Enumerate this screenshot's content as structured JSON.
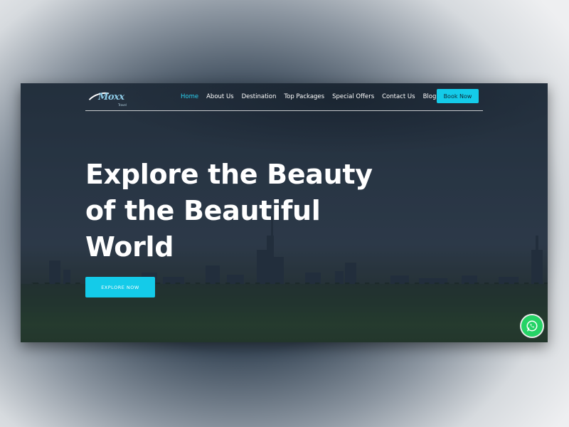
{
  "brand": {
    "logo_text": "Moxx",
    "logo_subtext": "Travel"
  },
  "nav": {
    "items": [
      {
        "label": "Home",
        "active": true
      },
      {
        "label": "About Us",
        "active": false
      },
      {
        "label": "Destination",
        "active": false
      },
      {
        "label": "Top Packages",
        "active": false
      },
      {
        "label": "Special Offers",
        "active": false
      },
      {
        "label": "Contact Us",
        "active": false
      },
      {
        "label": "Blog",
        "active": false
      }
    ],
    "cta_label": "Book Now"
  },
  "hero": {
    "title_line1": "Explore the Beauty",
    "title_line2": "of the Beautiful",
    "title_line3": "World",
    "button_label": "EXPLORE NOW"
  },
  "floating": {
    "chat_icon": "whatsapp-icon"
  },
  "colors": {
    "accent": "#14cbe9",
    "active_link": "#2bd0ef",
    "whatsapp": "#25d366"
  }
}
